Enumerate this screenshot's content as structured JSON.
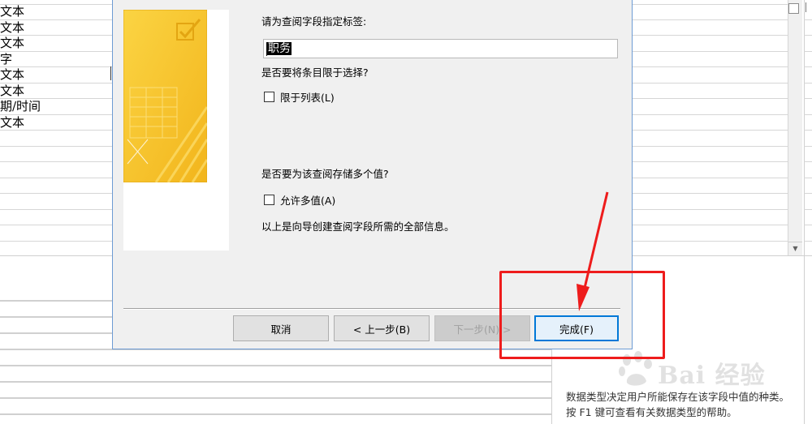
{
  "background_table": {
    "rows": [
      "文本",
      "文本",
      "字",
      "文本",
      "文本",
      "期/时间",
      "文本",
      "",
      "",
      "",
      "",
      "",
      "",
      "",
      ""
    ]
  },
  "dialog": {
    "prompt_label": "请为查阅字段指定标签:",
    "label_value": "职务",
    "limit_question": "是否要将条目限于选择?",
    "limit_checkbox_label": "限于列表(L)",
    "limit_checked": false,
    "multi_question": "是否要为该查阅存储多个值?",
    "multi_checkbox_label": "允许多值(A)",
    "multi_checked": false,
    "info_text": "以上是向导创建查阅字段所需的全部信息。",
    "buttons": {
      "cancel": "取消",
      "back": "< 上一步(B)",
      "next": "下一步(N) >",
      "finish": "完成(F)"
    }
  },
  "help_pane": {
    "text": "数据类型决定用户所能保存在该字段中值的种类。按 F1 键可查看有关数据类型的帮助。"
  },
  "watermark": {
    "text": "Bai  经验"
  },
  "colors": {
    "dialog_bg": "#f0f0f0",
    "dialog_border": "#6d9bd4",
    "annotation_red": "#ee1c1c",
    "art_yellow": "#f7c326",
    "default_button_border": "#0078d7"
  },
  "icons": {
    "art": "wizard-illustration",
    "scroll_down": "chevron-down-icon"
  }
}
